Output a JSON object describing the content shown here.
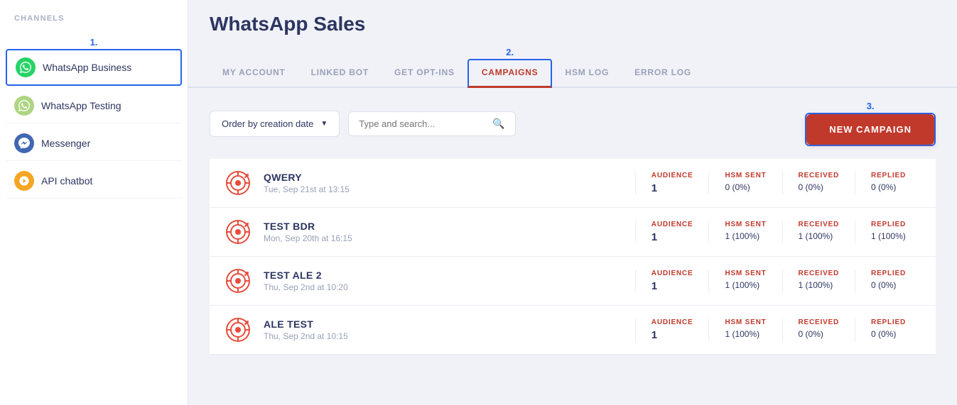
{
  "sidebar": {
    "section_label": "CHANNELS",
    "step1_label": "1.",
    "items": [
      {
        "id": "whatsapp-business",
        "label": "WhatsApp Business",
        "icon": "whatsapp",
        "icon_char": "✓",
        "active": true
      },
      {
        "id": "whatsapp-testing",
        "label": "WhatsApp Testing",
        "icon": "whatsapp-testing",
        "icon_char": "✓",
        "active": false
      },
      {
        "id": "messenger",
        "label": "Messenger",
        "icon": "messenger",
        "icon_char": "✈",
        "active": false
      },
      {
        "id": "api-chatbot",
        "label": "API chatbot",
        "icon": "api",
        "icon_char": "⚙",
        "active": false
      }
    ]
  },
  "main": {
    "title": "WhatsApp Sales",
    "tabs": [
      {
        "id": "my-account",
        "label": "MY ACCOUNT",
        "active": false
      },
      {
        "id": "linked-bot",
        "label": "LINKED BOT",
        "active": false
      },
      {
        "id": "get-opt-ins",
        "label": "GET OPT-INS",
        "active": false
      },
      {
        "id": "campaigns",
        "label": "CAMPAIGNS",
        "active": true
      },
      {
        "id": "hsm-log",
        "label": "HSM LOG",
        "active": false
      },
      {
        "id": "error-log",
        "label": "ERROR LOG",
        "active": false
      }
    ],
    "step2_label": "2.",
    "step3_label": "3.",
    "toolbar": {
      "order_label": "Order by creation date",
      "search_placeholder": "Type and search...",
      "new_campaign_label": "NEW CAMPAIGN"
    },
    "campaigns": [
      {
        "name": "QWERY",
        "date": "Tue, Sep 21st at 13:15",
        "audience": "1",
        "hsm_sent": "0 (0%)",
        "received": "0 (0%)",
        "replied": "0 (0%)"
      },
      {
        "name": "TEST BDR",
        "date": "Mon, Sep 20th at 16:15",
        "audience": "1",
        "hsm_sent": "1 (100%)",
        "received": "1 (100%)",
        "replied": "1 (100%)"
      },
      {
        "name": "TEST ALE 2",
        "date": "Thu, Sep 2nd at 10:20",
        "audience": "1",
        "hsm_sent": "1 (100%)",
        "received": "1 (100%)",
        "replied": "0 (0%)"
      },
      {
        "name": "ALE TEST",
        "date": "Thu, Sep 2nd at 10:15",
        "audience": "1",
        "hsm_sent": "1 (100%)",
        "received": "0 (0%)",
        "replied": "0 (0%)"
      }
    ],
    "stat_labels": {
      "audience": "AUDIENCE",
      "hsm_sent": "HSM SENT",
      "received": "RECEIVED",
      "replied": "REPLIED"
    }
  }
}
